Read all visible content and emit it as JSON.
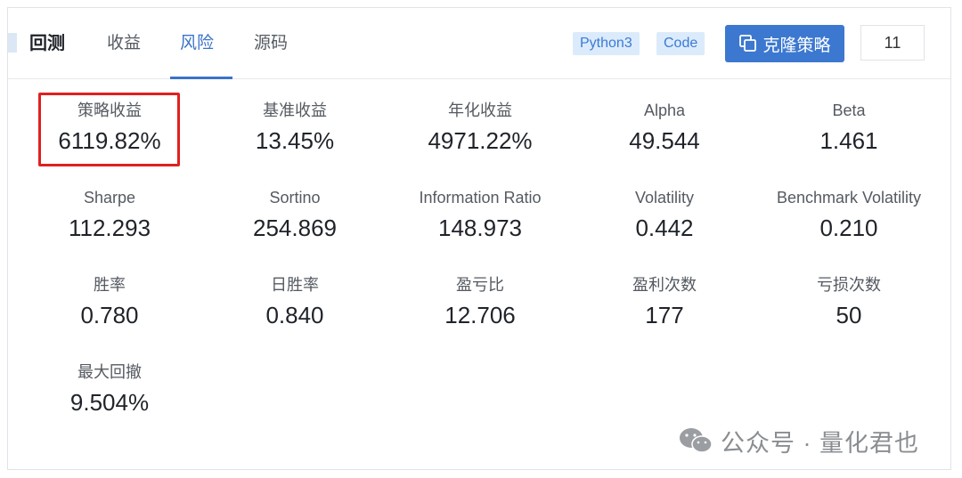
{
  "tabs": {
    "backtest": "回测",
    "returns": "收益",
    "risk": "风险",
    "source": "源码"
  },
  "tags": {
    "python": "Python3",
    "code": "Code"
  },
  "clone_button": "克隆策略",
  "count": "11",
  "metrics": {
    "strategy_return": {
      "label": "策略收益",
      "value": "6119.82%"
    },
    "benchmark_return": {
      "label": "基准收益",
      "value": "13.45%"
    },
    "annual_return": {
      "label": "年化收益",
      "value": "4971.22%"
    },
    "alpha": {
      "label": "Alpha",
      "value": "49.544"
    },
    "beta": {
      "label": "Beta",
      "value": "1.461"
    },
    "sharpe": {
      "label": "Sharpe",
      "value": "112.293"
    },
    "sortino": {
      "label": "Sortino",
      "value": "254.869"
    },
    "information_ratio": {
      "label": "Information Ratio",
      "value": "148.973"
    },
    "volatility": {
      "label": "Volatility",
      "value": "0.442"
    },
    "benchmark_volatility": {
      "label": "Benchmark Volatility",
      "value": "0.210"
    },
    "win_rate": {
      "label": "胜率",
      "value": "0.780"
    },
    "daily_win_rate": {
      "label": "日胜率",
      "value": "0.840"
    },
    "profit_loss_ratio": {
      "label": "盈亏比",
      "value": "12.706"
    },
    "profit_count": {
      "label": "盈利次数",
      "value": "177"
    },
    "loss_count": {
      "label": "亏损次数",
      "value": "50"
    },
    "max_drawdown": {
      "label": "最大回撤",
      "value": "9.504%"
    }
  },
  "watermark": "公众号 · 量化君也",
  "colors": {
    "accent": "#3a73c8",
    "button": "#3c78cf",
    "tag_bg": "#dcebfb",
    "highlight": "#e02020"
  }
}
